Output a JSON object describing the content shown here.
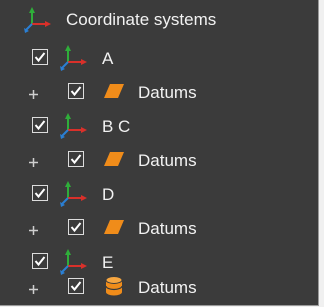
{
  "tree": {
    "root_label": "Coordinate systems",
    "nodes": [
      {
        "label": "A",
        "checked": true,
        "datums": {
          "label": "Datums",
          "checked": true,
          "icon": "parallelogram-plane-icon"
        }
      },
      {
        "label": "B C",
        "checked": true,
        "datums": {
          "label": "Datums",
          "checked": true,
          "icon": "parallelogram-plane-icon"
        }
      },
      {
        "label": "D",
        "checked": true,
        "datums": {
          "label": "Datums",
          "checked": true,
          "icon": "parallelogram-plane-icon"
        }
      },
      {
        "label": "E",
        "checked": true,
        "datums": {
          "label": "Datums",
          "checked": true,
          "icon": "cylinder-icon"
        }
      }
    ]
  },
  "colors": {
    "panel_bg": "#3b3b3b",
    "text": "#f2f2f2",
    "axis_x": "#d9302a",
    "axis_y": "#2fae3a",
    "axis_z": "#2a7fd4",
    "datum_fill": "#f08c1a"
  }
}
